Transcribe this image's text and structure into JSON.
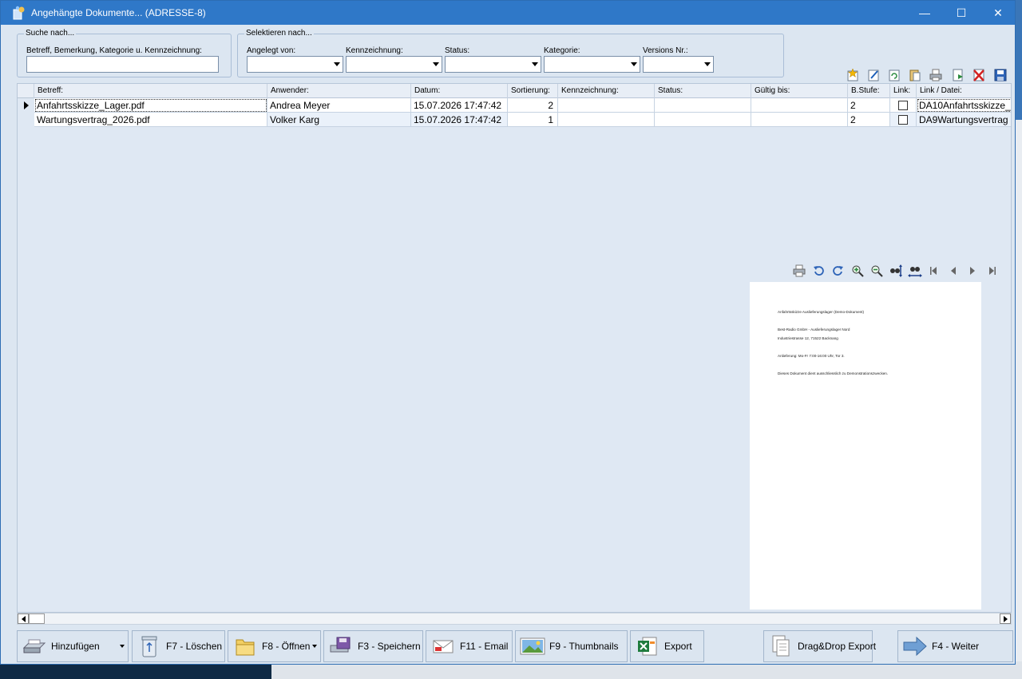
{
  "window": {
    "title": "Angehängte Dokumente... (ADRESSE-8)",
    "minimize": "—",
    "maximize": "☐",
    "close": "✕"
  },
  "search": {
    "legend": "Suche nach...",
    "label": "Betreff, Bemerkung, Kategorie u. Kennzeichnung:",
    "value": ""
  },
  "filter": {
    "legend": "Selektieren nach...",
    "fields": [
      {
        "label": "Angelegt von:",
        "value": ""
      },
      {
        "label": "Kennzeichnung:",
        "value": ""
      },
      {
        "label": "Status:",
        "value": ""
      },
      {
        "label": "Kategorie:",
        "value": ""
      },
      {
        "label": "Versions Nr.:",
        "value": ""
      }
    ]
  },
  "toolbar_icons": [
    "new-document-icon",
    "edit-icon",
    "refresh-icon",
    "paste-icon",
    "print-icon",
    "export-icon",
    "delete-icon",
    "save-icon"
  ],
  "grid": {
    "columns": [
      "Betreff:",
      "Anwender:",
      "Datum:",
      "Sortierung:",
      "Kennzeichnung:",
      "Status:",
      "Gültig bis:",
      "B.Stufe:",
      "Link:",
      "Link / Datei:"
    ],
    "rows": [
      {
        "betreff": "Anfahrtsskizze_Lager.pdf",
        "anwender": "Andrea Meyer",
        "datum": "15.07.2026 17:47:42",
        "sortierung": "2",
        "kennzeichnung": "",
        "status": "",
        "gueltig": "",
        "bstufe": "2",
        "link": false,
        "datei": "DA10Anfahrtsskizze_"
      },
      {
        "betreff": "Wartungsvertrag_2026.pdf",
        "anwender": "Volker Karg",
        "datum": "15.07.2026 17:47:42",
        "sortierung": "1",
        "kennzeichnung": "",
        "status": "",
        "gueltig": "",
        "bstufe": "2",
        "link": false,
        "datei": "DA9Wartungsvertrag"
      }
    ]
  },
  "preview_toolbar": [
    "print-icon",
    "rotate-left-icon",
    "rotate-right-icon",
    "zoom-in-icon",
    "zoom-out-icon",
    "fit-height-icon",
    "fit-width-icon",
    "first-page-icon",
    "prev-page-icon",
    "next-page-icon",
    "last-page-icon"
  ],
  "preview": {
    "lines": [
      "Anfahrtsskizze Auslieferungslager (Demo-Dokument)",
      "Best-Radio GmbH - Auslieferungslager Nord",
      "Industriestrasse 12, 71522 Backnang",
      "Anlieferung: Mo-Fr 7:00-16:00 Uhr, Tor 3.",
      "Dieses Dokument dient ausschliesslich zu Demonstrationszwecken."
    ]
  },
  "buttons": [
    {
      "label": "Hinzufügen",
      "key": ""
    },
    {
      "label": "F7 - Löschen",
      "key": "F7"
    },
    {
      "label": "F8 - Öffnen",
      "key": "F8"
    },
    {
      "label": "F3 - Speichern",
      "key": "F3"
    },
    {
      "label": "F11 - Email",
      "key": "F11"
    },
    {
      "label": "F9 - Thumbnails",
      "key": "F9"
    },
    {
      "label": "Export",
      "key": ""
    },
    {
      "label": "Drag&Drop Export",
      "key": ""
    },
    {
      "label": "F4 - Weiter",
      "key": "F4"
    }
  ]
}
